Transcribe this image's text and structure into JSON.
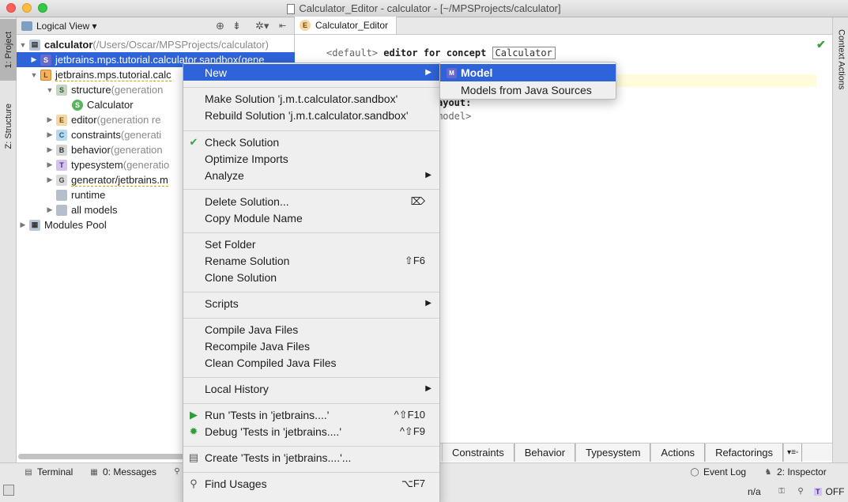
{
  "window": {
    "title": "Calculator_Editor - calculator - [~/MPSProjects/calculator]"
  },
  "left_strip": {
    "project_tab": "1: Project",
    "structure_tab": "Z: Structure"
  },
  "right_strip": {
    "context_actions": "Context Actions"
  },
  "project_panel": {
    "view_selector": "Logical View ▾",
    "tree": [
      {
        "label": "calculator",
        "detail": " (/Users/Oscar/MPSProjects/calculator)",
        "icon": "project-icon",
        "bold": true
      },
      {
        "label": "jetbrains.mps.tutorial.calculator.sandbox",
        "detail": " (gene",
        "icon": "solution-icon",
        "selected": true
      },
      {
        "label": "jetbrains.mps.tutorial.calc",
        "detail": "",
        "icon": "language-icon"
      },
      {
        "label": "structure",
        "detail": " (generation",
        "icon": "structure-aspect-icon"
      },
      {
        "label": "Calculator",
        "detail": "",
        "icon": "concept-icon"
      },
      {
        "label": "editor",
        "detail": " (generation re",
        "icon": "editor-aspect-icon"
      },
      {
        "label": "constraints",
        "detail": " (generati",
        "icon": "constraints-aspect-icon"
      },
      {
        "label": "behavior",
        "detail": " (generation",
        "icon": "behavior-aspect-icon"
      },
      {
        "label": "typesystem",
        "detail": " (generatio",
        "icon": "typesystem-aspect-icon"
      },
      {
        "label": "generator/jetbrains.m",
        "detail": "",
        "icon": "generator-icon"
      },
      {
        "label": "runtime",
        "detail": "",
        "icon": "folder-icon"
      },
      {
        "label": "all models",
        "detail": "",
        "icon": "folder-icon"
      },
      {
        "label": "Modules Pool",
        "detail": "",
        "icon": "modules-pool-icon"
      }
    ]
  },
  "editor": {
    "tab_label": "Calculator_Editor",
    "code_default": "<default>",
    "code_editor_for": " editor for concept ",
    "code_concept": "Calculator",
    "code_layout": "ayout:",
    "code_model": "model>"
  },
  "editor_bottom_tabs": [
    "Constraints",
    "Behavior",
    "Typesystem",
    "Actions",
    "Refactorings"
  ],
  "context_menu": {
    "items": [
      {
        "label": "New",
        "submenu": true,
        "highlighted": true
      },
      {
        "label": "Make Solution 'j.m.t.calculator.sandbox'"
      },
      {
        "label": "Rebuild Solution 'j.m.t.calculator.sandbox'"
      },
      {
        "label": "Check Solution",
        "icon": "check-icon"
      },
      {
        "label": "Optimize Imports"
      },
      {
        "label": "Analyze",
        "submenu": true
      },
      {
        "label": "Delete Solution...",
        "shortcut": "⌦"
      },
      {
        "label": "Copy Module Name"
      },
      {
        "label": "Set Folder"
      },
      {
        "label": "Rename Solution",
        "shortcut": "⇧F6"
      },
      {
        "label": "Clone Solution"
      },
      {
        "label": "Scripts",
        "submenu": true
      },
      {
        "label": "Compile Java Files"
      },
      {
        "label": "Recompile Java Files"
      },
      {
        "label": "Clean Compiled Java Files"
      },
      {
        "label": "Local History",
        "submenu": true
      },
      {
        "label": "Run 'Tests in 'jetbrains....'",
        "shortcut": "^⇧F10",
        "icon": "run-icon"
      },
      {
        "label": "Debug 'Tests in 'jetbrains....'",
        "shortcut": "^⇧F9",
        "icon": "debug-icon"
      },
      {
        "label": "Create 'Tests in 'jetbrains....'...",
        "icon": "create-config-icon"
      },
      {
        "label": "Find Usages",
        "shortcut": "⌥F7",
        "icon": "find-usages-icon"
      }
    ]
  },
  "submenu": {
    "items": [
      "Model",
      "Models from Java Sources"
    ]
  },
  "status_bar": {
    "terminal": "Terminal",
    "messages": "0: Messages",
    "event_log": "Event Log",
    "inspector": "2: Inspector",
    "na": "n/a",
    "off": "OFF"
  }
}
